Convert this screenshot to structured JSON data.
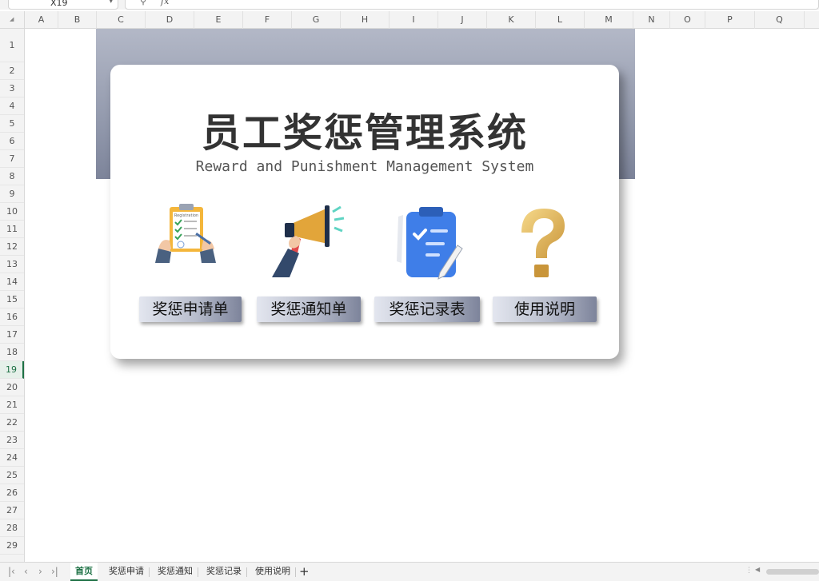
{
  "formula_bar": {
    "name_box": "X19",
    "zoom_icon": "search-icon",
    "fx_label": "fx"
  },
  "columns": [
    "A",
    "B",
    "C",
    "D",
    "E",
    "F",
    "G",
    "H",
    "I",
    "J",
    "K",
    "L",
    "M",
    "N",
    "O",
    "P",
    "Q"
  ],
  "rows": [
    "1",
    "2",
    "3",
    "4",
    "5",
    "6",
    "7",
    "8",
    "9",
    "10",
    "11",
    "12",
    "13",
    "14",
    "15",
    "16",
    "17",
    "18",
    "19",
    "20",
    "21",
    "22",
    "23",
    "24",
    "25",
    "26",
    "27",
    "28",
    "29"
  ],
  "active_row": "19",
  "card": {
    "title": "员工奖惩管理系统",
    "subtitle": "Reward and Punishment Management System"
  },
  "menu": [
    {
      "label": "奖惩申请单",
      "icon": "clipboard-checklist-icon"
    },
    {
      "label": "奖惩通知单",
      "icon": "megaphone-icon"
    },
    {
      "label": "奖惩记录表",
      "icon": "clipboard-pencil-icon"
    },
    {
      "label": "使用说明",
      "icon": "question-mark-icon"
    }
  ],
  "sheet_tabs": [
    "首页",
    "奖惩申请",
    "奖惩通知",
    "奖惩记录",
    "使用说明"
  ],
  "active_tab": "首页",
  "colors": {
    "accent_green": "#1e7145",
    "banner": "#8e95a9",
    "button_dark": "#7d849b"
  }
}
